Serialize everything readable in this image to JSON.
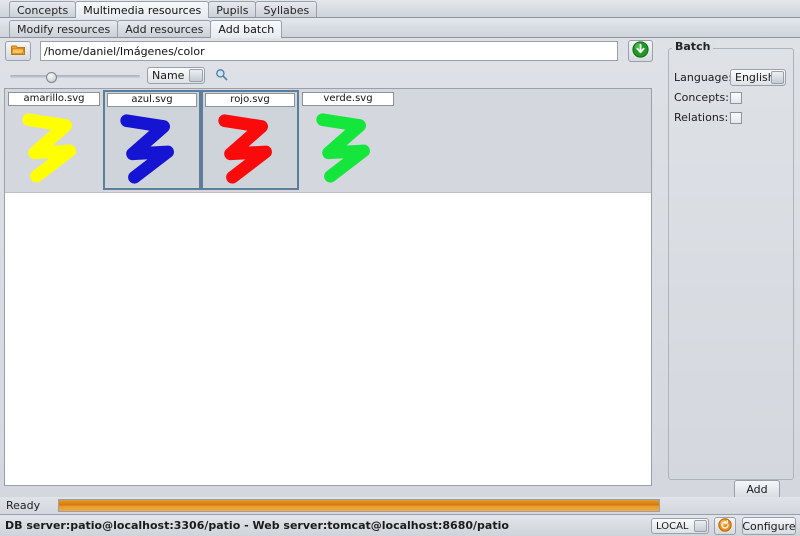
{
  "main_tabs": [
    {
      "label": "Concepts",
      "active": false
    },
    {
      "label": "Multimedia resources",
      "active": true
    },
    {
      "label": "Pupils",
      "active": false
    },
    {
      "label": "Syllabes",
      "active": false
    }
  ],
  "sub_tabs": [
    {
      "label": "Modify resources",
      "active": false
    },
    {
      "label": "Add resources",
      "active": false
    },
    {
      "label": "Add batch",
      "active": true
    }
  ],
  "toolbar": {
    "browse_icon": "folder-icon",
    "path_value": "/home/daniel/Imágenes/color",
    "path_placeholder": "",
    "go_icon": "go-down-icon",
    "zoom_slider_value": 30,
    "sort_selected": "Name",
    "sort_options": [
      "Name"
    ],
    "search_icon": "magnifier-icon"
  },
  "thumbnails": [
    {
      "name": "amarillo.svg",
      "color": "#ffff00",
      "selected": false
    },
    {
      "name": "azul.svg",
      "color": "#1414d2",
      "selected": true
    },
    {
      "name": "rojo.svg",
      "color": "#fa0a0a",
      "selected": true
    },
    {
      "name": "verde.svg",
      "color": "#14e63c",
      "selected": false
    }
  ],
  "batch": {
    "title": "Batch",
    "language_label": "Language:",
    "language_selected": "English",
    "language_options": [
      "English"
    ],
    "concepts_label": "Concepts:",
    "concepts_checked": false,
    "relations_label": "Relations:",
    "relations_checked": false,
    "add_label": "Add"
  },
  "status": {
    "text": "Ready",
    "progress_percent": 100
  },
  "bottom": {
    "server_info": "DB server:patio@localhost:3306/patio - Web server:tomcat@localhost:8680/patio",
    "scope_selected": "LOCAL",
    "scope_options": [
      "LOCAL"
    ],
    "refresh_icon": "refresh-icon",
    "configure_label": "Configure"
  },
  "colors": {
    "selection_border": "#5e7d99",
    "progress": "#d5780d",
    "panel_bg": "#d6d9de"
  }
}
